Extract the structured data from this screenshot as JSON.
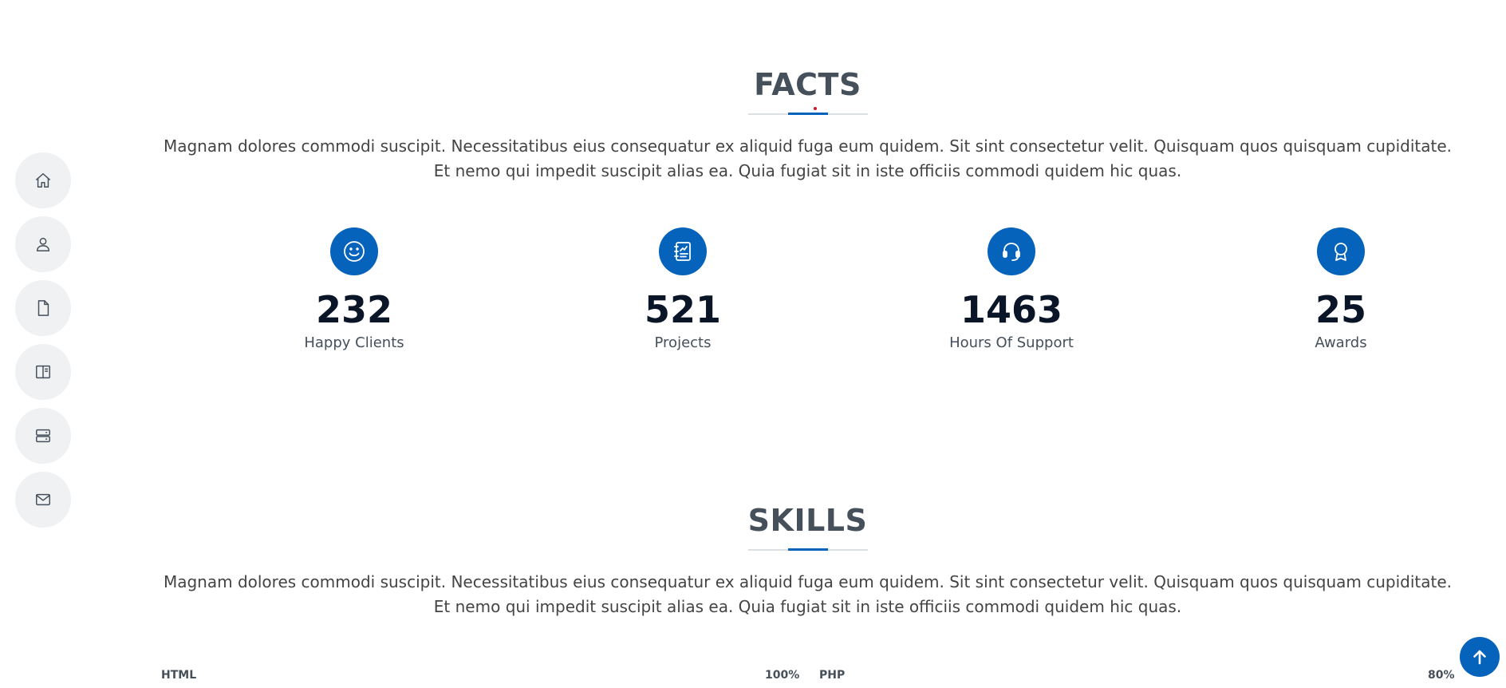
{
  "sidebar": {
    "items": [
      {
        "name": "home",
        "icon": "house-icon"
      },
      {
        "name": "about",
        "icon": "person-icon"
      },
      {
        "name": "resume",
        "icon": "file-icon"
      },
      {
        "name": "portfolio",
        "icon": "book-half-icon"
      },
      {
        "name": "services",
        "icon": "server-icon"
      },
      {
        "name": "contact",
        "icon": "envelope-icon"
      }
    ]
  },
  "facts": {
    "title": "FACTS",
    "description": "Magnam dolores commodi suscipit. Necessitatibus eius consequatur ex aliquid fuga eum quidem. Sit sint consectetur velit. Quisquam quos quisquam cupiditate. Et nemo qui impedit suscipit alias ea. Quia fugiat sit in iste officiis commodi quidem hic quas.",
    "items": [
      {
        "count": "232",
        "label": "Happy Clients",
        "icon": "emoji-smile-icon"
      },
      {
        "count": "521",
        "label": "Projects",
        "icon": "journal-richtext-icon"
      },
      {
        "count": "1463",
        "label": "Hours Of Support",
        "icon": "headset-icon"
      },
      {
        "count": "25",
        "label": "Awards",
        "icon": "award-icon"
      }
    ]
  },
  "skills": {
    "title": "SKILLS",
    "description": "Magnam dolores commodi suscipit. Necessitatibus eius consequatur ex aliquid fuga eum quidem. Sit sint consectetur velit. Quisquam quos quisquam cupiditate. Et nemo qui impedit suscipit alias ea. Quia fugiat sit in iste officiis commodi quidem hic quas.",
    "items": [
      {
        "name": "HTML",
        "value": "100%"
      },
      {
        "name": "PHP",
        "value": "80%"
      }
    ]
  },
  "colors": {
    "accent": "#0563bb",
    "heading": "#45505b",
    "dot": "#d0152b"
  }
}
